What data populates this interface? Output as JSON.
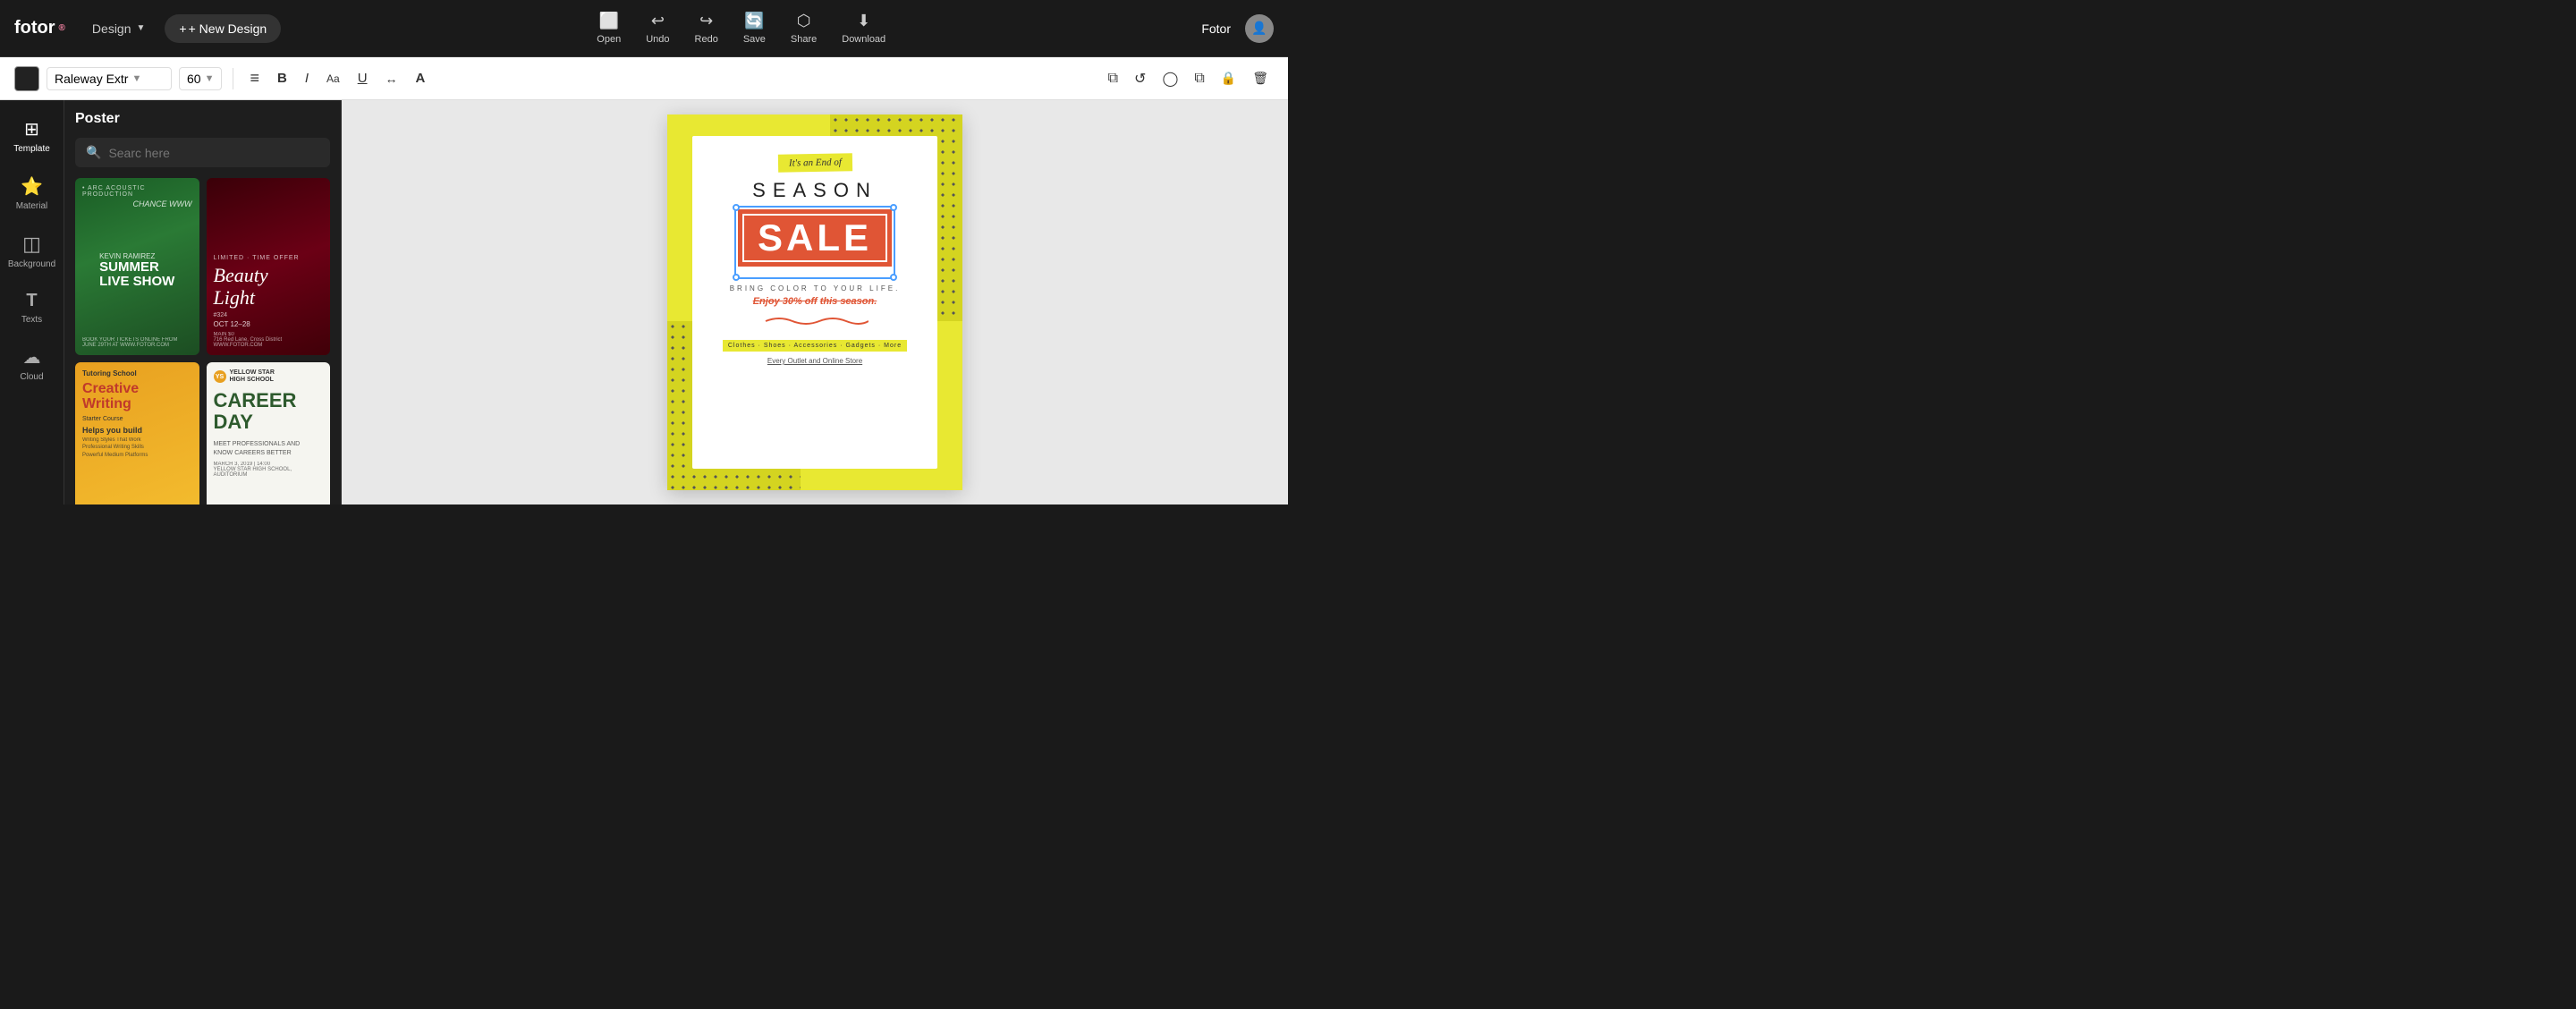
{
  "logo": {
    "text": "fotor",
    "superscript": "®"
  },
  "header": {
    "design_label": "Design",
    "new_design_label": "+ New Design",
    "nav_actions": [
      {
        "id": "open",
        "label": "Open",
        "icon": "⬜"
      },
      {
        "id": "undo",
        "label": "Undo",
        "icon": "↩"
      },
      {
        "id": "redo",
        "label": "Redo",
        "icon": "↪"
      },
      {
        "id": "save",
        "label": "Save",
        "icon": "🔄"
      },
      {
        "id": "share",
        "label": "Share",
        "icon": "⬡"
      },
      {
        "id": "download",
        "label": "Download",
        "icon": "⬇"
      }
    ],
    "user_name": "Fotor",
    "avatar_emoji": "👤"
  },
  "toolbar": {
    "font_color": "#222222",
    "font_name": "Raleway Extr",
    "font_size": "60",
    "buttons": [
      {
        "id": "align",
        "icon": "≡",
        "label": "align"
      },
      {
        "id": "bold",
        "icon": "B",
        "label": "bold"
      },
      {
        "id": "italic",
        "icon": "I",
        "label": "italic"
      },
      {
        "id": "size-aa",
        "icon": "Aa",
        "label": "text size"
      },
      {
        "id": "underline",
        "icon": "U",
        "label": "underline"
      },
      {
        "id": "spacing",
        "icon": "↔",
        "label": "spacing"
      },
      {
        "id": "case",
        "icon": "A",
        "label": "case"
      }
    ],
    "right_buttons": [
      {
        "id": "duplicate",
        "icon": "⧉",
        "label": "duplicate"
      },
      {
        "id": "refresh",
        "icon": "↺",
        "label": "refresh"
      },
      {
        "id": "circle",
        "icon": "◯",
        "label": "circle"
      },
      {
        "id": "layers",
        "icon": "⧉",
        "label": "layers"
      },
      {
        "id": "lock",
        "icon": "🔒",
        "label": "lock"
      },
      {
        "id": "delete",
        "icon": "🗑",
        "label": "delete"
      }
    ]
  },
  "sidebar": {
    "items": [
      {
        "id": "template",
        "label": "Template",
        "icon": "⊞",
        "active": true
      },
      {
        "id": "material",
        "label": "Material",
        "icon": "⭐"
      },
      {
        "id": "background",
        "label": "Background",
        "icon": "◫"
      },
      {
        "id": "texts",
        "label": "Texts",
        "icon": "T"
      },
      {
        "id": "cloud",
        "label": "Cloud",
        "icon": "☁"
      }
    ]
  },
  "template_panel": {
    "title": "Poster",
    "search_placeholder": "Searc here",
    "templates": [
      {
        "id": "summer",
        "title": "SUMMER LIVE SHOW",
        "subtitle": "Kevin Ramirez",
        "style": "summer"
      },
      {
        "id": "beauty",
        "title": "Beauty Light",
        "subtitle": "Limited Time Offer",
        "style": "beauty"
      },
      {
        "id": "creative",
        "title": "Creative Writing",
        "subtitle": "Tutoring School",
        "style": "creative"
      },
      {
        "id": "career",
        "title": "CAREER DAY",
        "subtitle": "Yellow Star High School",
        "style": "career"
      }
    ]
  },
  "canvas": {
    "poster": {
      "tag_text": "It's an End of",
      "season_text": "SEASON",
      "sale_text": "SALE",
      "bring_color": "BRING COLOR TO YOUR LIFE.",
      "enjoy_text": "Enjoy",
      "discount": "30% off",
      "this_season": "this season.",
      "categories": "Clothes · Shoes · Accessories · Gadgets · More",
      "store_link": "Every Outlet and Online Store"
    }
  },
  "colors": {
    "bg_dark": "#1a1a1a",
    "accent_yellow": "#e8e832",
    "accent_red": "#e05535",
    "panel_bg": "#1e1e1e"
  }
}
